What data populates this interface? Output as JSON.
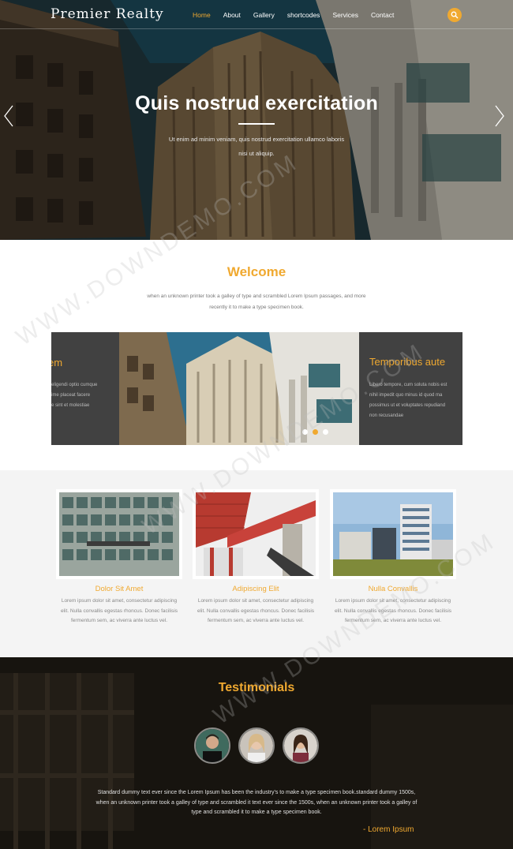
{
  "brand": {
    "name": "Premier Realty"
  },
  "nav": {
    "items": [
      {
        "label": "Home",
        "active": true
      },
      {
        "label": "About"
      },
      {
        "label": "Gallery"
      },
      {
        "label": "shortcodes"
      },
      {
        "label": "Services"
      },
      {
        "label": "Contact"
      }
    ],
    "search_icon": "search-icon"
  },
  "hero": {
    "title": "Quis nostrud exercitation",
    "text": "Ut enim ad minim veniam, quis nostrud exercitation ullamco laboris nisi ut aliquip."
  },
  "welcome": {
    "title": "Welcome",
    "text": "when an unknown printer took a galley of type and scrambled Lorem Ipsum passages, and more recently it to make a type specimen book."
  },
  "slider": {
    "left_title": "em",
    "left_lines": [
      "eligendi optio cumque",
      "ime placeat facere",
      "e sint et molestiae"
    ],
    "right_title": "Temporibus aute",
    "right_lines": [
      "Libero tempore, cum soluta nobis est",
      "nihil impedit quo minus id quod ma",
      "possimus ut et voluptates repudiand",
      "non recusandae"
    ],
    "active_dot": 1
  },
  "features": [
    {
      "title": "Dolor Sit Amet",
      "text": "Lorem ipsum dolor sit amet, consectetur adipiscing elit. Nulla convallis egestas rhoncus. Donec facilisis fermentum sem, ac viverra ante luctus vel."
    },
    {
      "title": "Adipiscing Elit",
      "text": "Lorem ipsum dolor sit amet, consectetur adipiscing elit. Nulla convallis egestas rhoncus. Donec facilisis fermentum sem, ac viverra ante luctus vel."
    },
    {
      "title": "Nulla Convallis",
      "text": "Lorem ipsum dolor sit amet, consectetur adipiscing elit. Nulla convallis egestas rhoncus. Donec facilisis fermentum sem, ac viverra ante luctus vel."
    }
  ],
  "testimonials": {
    "title": "Testimonials",
    "quote": "Standard dummy text ever since the Lorem Ipsum has been the industry's to make a type specimen book.standard dummy 1500s, when an unknown printer took a galley of type and scrambled it text ever since the 1500s, when an unknown printer took a galley of type and scrambled it to make a type specimen book.",
    "author": "- Lorem Ipsum"
  },
  "watermark": "WWW.DOWNDEMO.COM",
  "colors": {
    "accent": "#f0a930",
    "dark": "#414141"
  }
}
